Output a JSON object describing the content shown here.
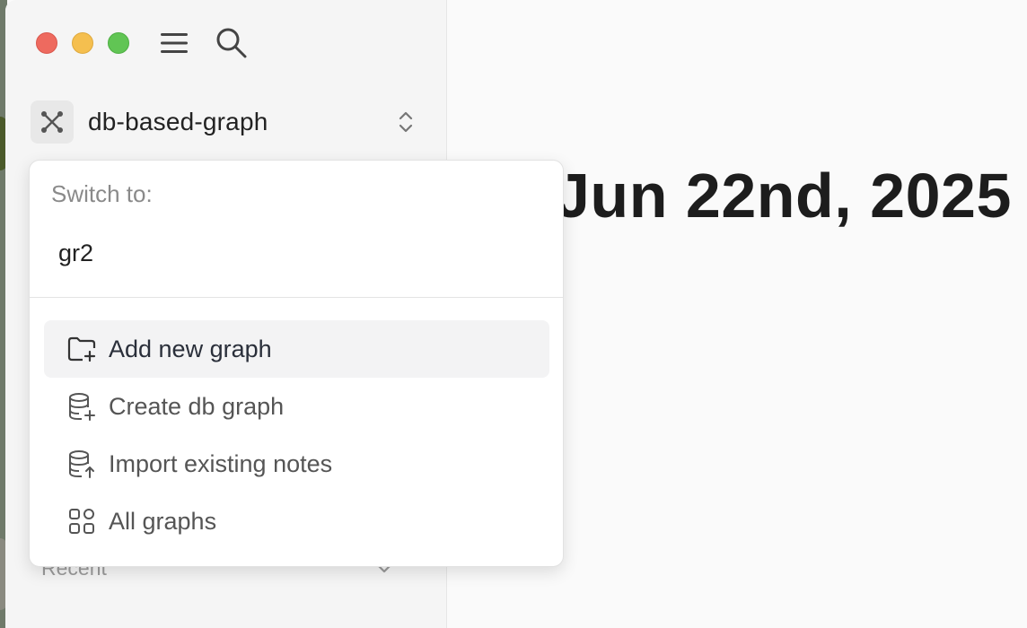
{
  "sidebar": {
    "graph": {
      "name": "db-based-graph",
      "icon": "graph-nodes-icon"
    },
    "recent_label": "Recent"
  },
  "main": {
    "date_title": "Jun 22nd, 2025"
  },
  "dropdown": {
    "switch_label": "Switch to:",
    "switch_items": [
      {
        "label": "gr2"
      }
    ],
    "actions": [
      {
        "label": "Add new graph",
        "icon": "folder-plus-icon",
        "active": true
      },
      {
        "label": "Create db graph",
        "icon": "database-plus-icon"
      },
      {
        "label": "Import existing notes",
        "icon": "database-import-icon"
      },
      {
        "label": "All graphs",
        "icon": "apps-grid-icon"
      }
    ]
  },
  "colors": {
    "close": "#ee6a5f",
    "minimize": "#f5bf4f",
    "maximize": "#61c554",
    "accent_hover": "#f3f3f4"
  }
}
